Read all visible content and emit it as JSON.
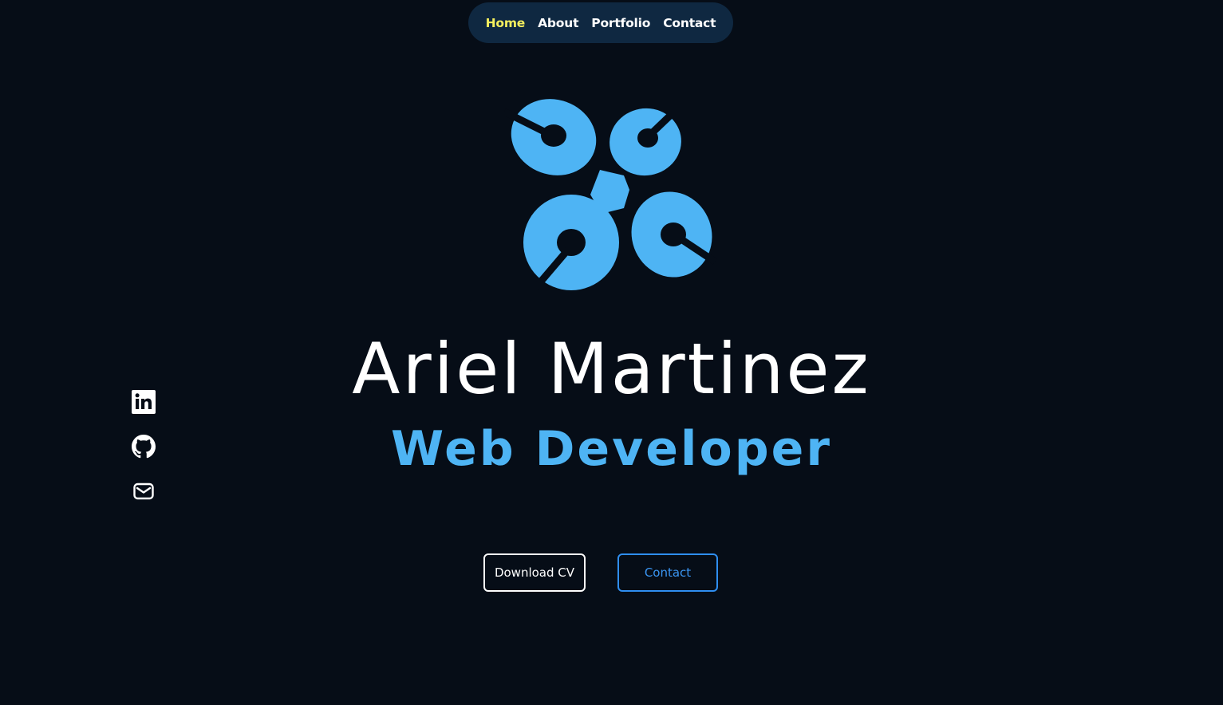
{
  "nav": {
    "items": [
      {
        "label": "Home",
        "active": true
      },
      {
        "label": "About",
        "active": false
      },
      {
        "label": "Portfolio",
        "active": false
      },
      {
        "label": "Contact",
        "active": false
      }
    ]
  },
  "hero": {
    "name": "Ariel Martinez",
    "role": "Web Developer",
    "logo_icon": "four-ring-logo-icon"
  },
  "social": [
    {
      "icon": "linkedin-icon"
    },
    {
      "icon": "github-icon"
    },
    {
      "icon": "mail-icon"
    }
  ],
  "buttons": {
    "download_cv": "Download CV",
    "contact": "Contact"
  },
  "colors": {
    "background": "#060d17",
    "nav_background": "#0f2841",
    "active_nav": "#f4ef5e",
    "accent": "#4eb4f4",
    "contact_button": "#2f8ef0"
  }
}
